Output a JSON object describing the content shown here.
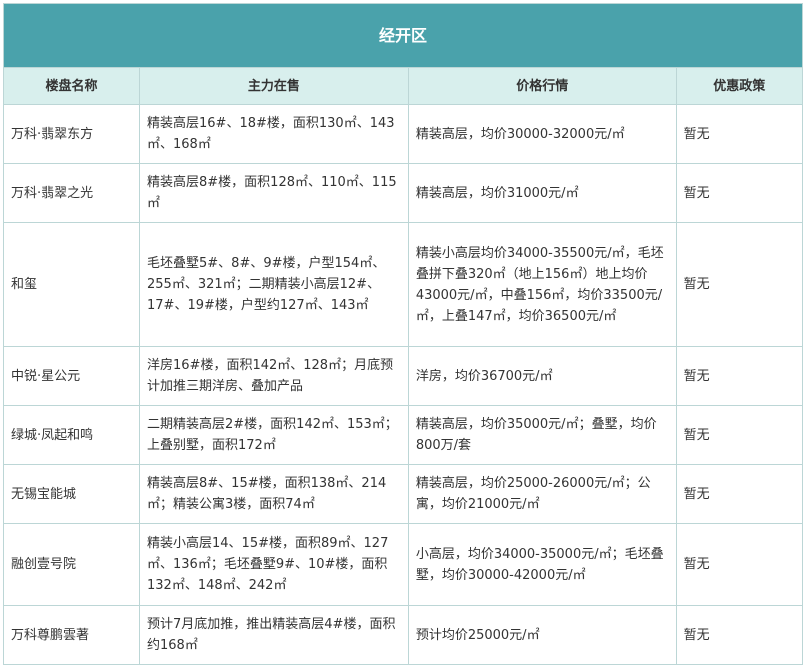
{
  "region_title": "经开区",
  "columns": [
    "楼盘名称",
    "主力在售",
    "价格行情",
    "优惠政策"
  ],
  "rows": [
    {
      "name": "万科·翡翠东方",
      "sale": "精装高层16#、18#楼，面积130㎡、143㎡、168㎡",
      "price": "精装高层，均价30000-32000元/㎡",
      "policy": "暂无"
    },
    {
      "name": "万科·翡翠之光",
      "sale": "精装高层8#楼，面积128㎡、110㎡、115㎡",
      "price": "精装高层，均价31000元/㎡",
      "policy": "暂无"
    },
    {
      "name": "和玺",
      "sale": "毛坯叠墅5#、8#、9#楼，户型154㎡、255㎡、321㎡；二期精装小高层12#、17#、19#楼，户型约127㎡、143㎡",
      "price": "精装小高层均价34000-35500元/㎡，毛坯叠拼下叠320㎡（地上156㎡）地上均价43000元/㎡，中叠156㎡，均价33500元/㎡，上叠147㎡，均价36500元/㎡",
      "policy": "暂无"
    },
    {
      "name": "中锐·星公元",
      "sale": "洋房16#楼，面积142㎡、128㎡；月底预计加推三期洋房、叠加产品",
      "price": "洋房，均价36700元/㎡",
      "policy": "暂无"
    },
    {
      "name": "绿城·凤起和鸣",
      "sale": "二期精装高层2#楼，面积142㎡、153㎡；上叠别墅，面积172㎡",
      "price": "精装高层，均价35000元/㎡；叠墅，均价800万/套",
      "policy": "暂无"
    },
    {
      "name": "无锡宝能城",
      "sale": "精装高层8#、15#楼，面积138㎡、214㎡；精装公寓3楼，面积74㎡",
      "price": "精装高层，均价25000-26000元/㎡；公寓，均价21000元/㎡",
      "policy": "暂无"
    },
    {
      "name": "融创壹号院",
      "sale": "精装小高层14、15#楼，面积89㎡、127㎡、136㎡；毛坯叠墅9#、10#楼，面积132㎡、148㎡、242㎡",
      "price": "小高层，均价34000-35000元/㎡；毛坯叠墅，均价30000-42000元/㎡",
      "policy": "暂无"
    },
    {
      "name": "万科尊鹏雲著",
      "sale": "预计7月底加推，推出精装高层4#楼，面积约168㎡",
      "price": "预计均价25000元/㎡",
      "policy": "暂无"
    }
  ]
}
